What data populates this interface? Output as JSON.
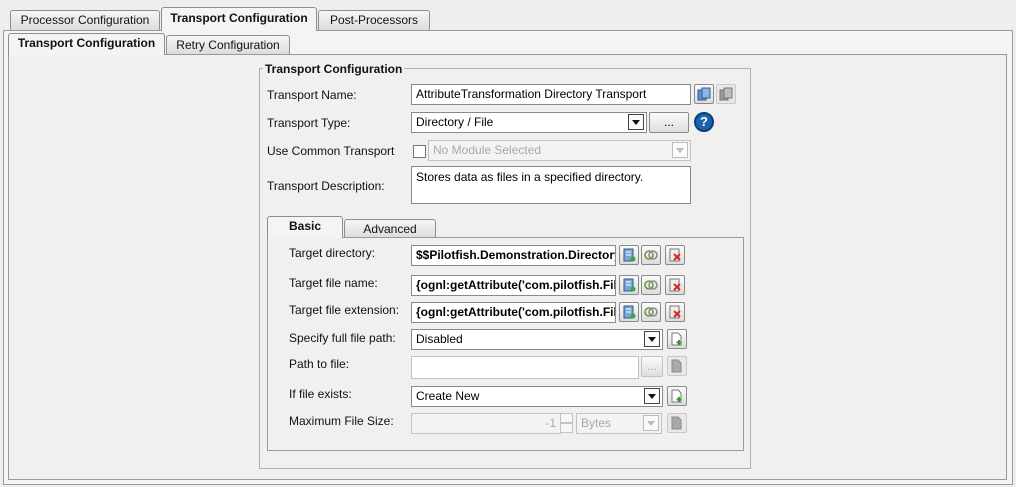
{
  "top_tabs": [
    "Processor Configuration",
    "Transport Configuration",
    "Post-Processors"
  ],
  "sub_tabs": [
    "Transport Configuration",
    "Retry Configuration"
  ],
  "group_title": "Transport Configuration",
  "form": {
    "name_label": "Transport Name:",
    "name_value": "AttributeTransformation Directory Transport",
    "type_label": "Transport Type:",
    "type_value": "Directory / File",
    "type_browse": "...",
    "help_glyph": "?",
    "common_label": "Use Common Transport",
    "common_placeholder": "No Module Selected",
    "desc_label": "Transport Description:",
    "desc_value": "Stores data as files in a specified directory."
  },
  "inner_tabs": [
    "Basic",
    "Advanced"
  ],
  "basic": {
    "target_dir_label": "Target directory:",
    "target_dir_value": "$$Pilotfish.Demonstration.Directory",
    "target_name_label": "Target file name:",
    "target_name_value": "{ognl:getAttribute('com.pilotfish.File",
    "target_ext_label": "Target file extension:",
    "target_ext_value": "{ognl:getAttribute('com.pilotfish.File",
    "full_path_label": "Specify full file path:",
    "full_path_value": "Disabled",
    "path_label": "Path to file:",
    "path_value": "",
    "path_browse": "...",
    "exists_label": "If file exists:",
    "exists_value": "Create New",
    "max_size_label": "Maximum File Size:",
    "max_size_value": "-1",
    "max_size_unit": "Bytes"
  }
}
